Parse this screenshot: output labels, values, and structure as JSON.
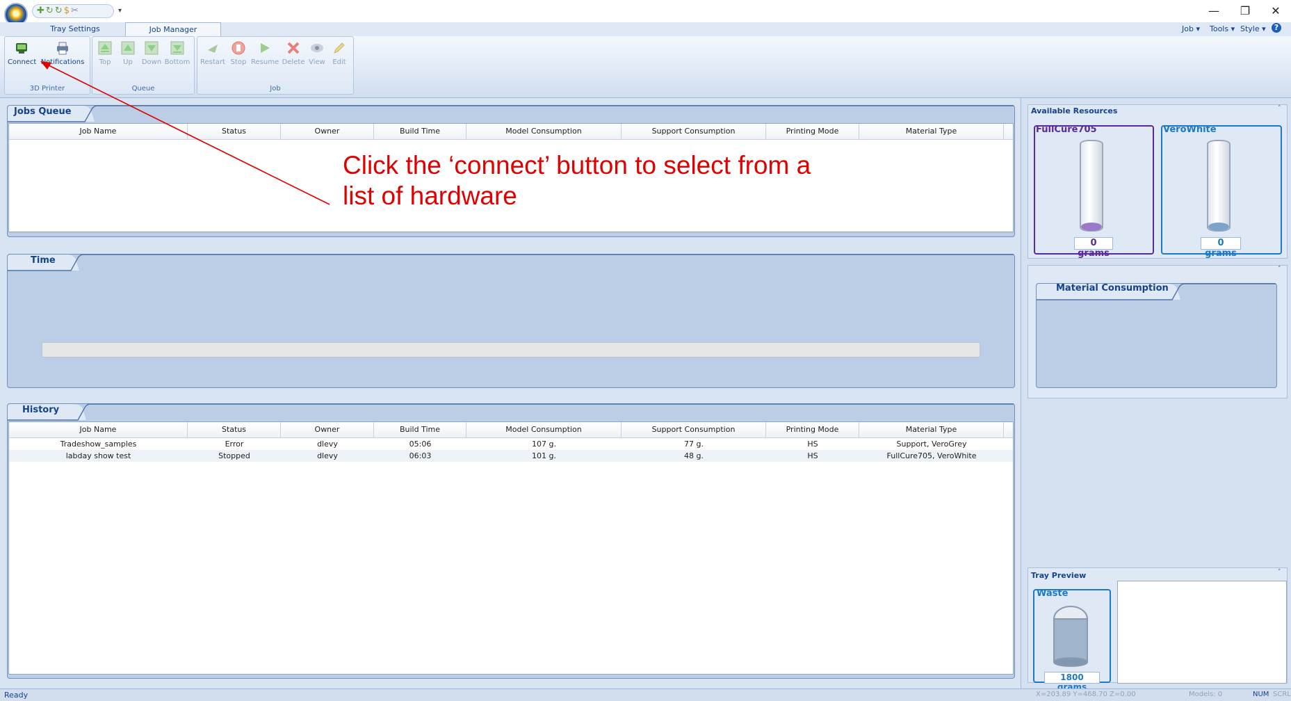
{
  "title_bar": {
    "quick_access_icons": [
      "new-icon",
      "open-icon",
      "save-icon",
      "money-icon",
      "scissor-icon"
    ],
    "window_controls": {
      "minimize": "—",
      "restore": "❐",
      "close": "✕"
    }
  },
  "tabs": [
    {
      "label": "Tray Settings",
      "active": false
    },
    {
      "label": "Job Manager",
      "active": true
    }
  ],
  "right_menu": {
    "job": "Job",
    "tools": "Tools",
    "style": "Style",
    "help": "?"
  },
  "ribbon": {
    "groups": [
      {
        "label": "3D Printer",
        "buttons": [
          {
            "label": "Connect",
            "icon": "connect-icon",
            "enabled": true
          },
          {
            "label": "Notifications",
            "icon": "printer-icon",
            "enabled": true
          }
        ]
      },
      {
        "label": "Queue",
        "buttons": [
          {
            "label": "Top",
            "icon": "top-icon",
            "enabled": false
          },
          {
            "label": "Up",
            "icon": "up-icon",
            "enabled": false
          },
          {
            "label": "Down",
            "icon": "down-icon",
            "enabled": false
          },
          {
            "label": "Bottom",
            "icon": "bottom-icon",
            "enabled": false
          }
        ]
      },
      {
        "label": "Job",
        "buttons": [
          {
            "label": "Restart",
            "icon": "restart-icon",
            "enabled": false
          },
          {
            "label": "Stop",
            "icon": "stop-icon",
            "enabled": false
          },
          {
            "label": "Resume",
            "icon": "resume-icon",
            "enabled": false
          },
          {
            "label": "Delete",
            "icon": "delete-icon",
            "enabled": false
          },
          {
            "label": "View",
            "icon": "view-icon",
            "enabled": false
          },
          {
            "label": "Edit",
            "icon": "edit-icon",
            "enabled": false
          }
        ]
      }
    ]
  },
  "jobs_queue": {
    "title": "Jobs Queue",
    "columns": [
      "Job Name",
      "Status",
      "Owner",
      "Build Time",
      "Model Consumption",
      "Support Consumption",
      "Printing Mode",
      "Material Type"
    ],
    "rows": []
  },
  "annotation": {
    "line1": "Click the ‘connect’ button to select from a",
    "line2": "list of hardware",
    "color": "#e00000"
  },
  "time_panel": {
    "title": "Time"
  },
  "history": {
    "title": "History",
    "columns": [
      "Job Name",
      "Status",
      "Owner",
      "Build Time",
      "Model Consumption",
      "Support Consumption",
      "Printing Mode",
      "Material Type"
    ],
    "rows": [
      [
        "Tradeshow_samples",
        "Error",
        "dlevy",
        "05:06",
        "107 g.",
        "77 g.",
        "HS",
        "Support, VeroGrey"
      ],
      [
        "labday show test",
        "Stopped",
        "dlevy",
        "06:03",
        "101 g.",
        "48 g.",
        "HS",
        "FullCure705, VeroWhite"
      ]
    ]
  },
  "available_resources": {
    "title": "Available Resources",
    "materials": [
      {
        "name": "FullCure705",
        "amount": "0 grams",
        "color": "#5b2a9a"
      },
      {
        "name": "VeroWhite",
        "amount": "0 grams",
        "color": "#1d78c8"
      }
    ]
  },
  "material_consumption": {
    "title": "Material Consumption"
  },
  "tray_preview": {
    "title": "Tray Preview",
    "waste_label": "Waste",
    "waste_amount": "1800 grams"
  },
  "status_bar": {
    "status": "Ready",
    "coords": "X=203.89 Y=468.70 Z=0.00",
    "models": "Models: 0",
    "num": "NUM",
    "scrl": "SCRL"
  }
}
